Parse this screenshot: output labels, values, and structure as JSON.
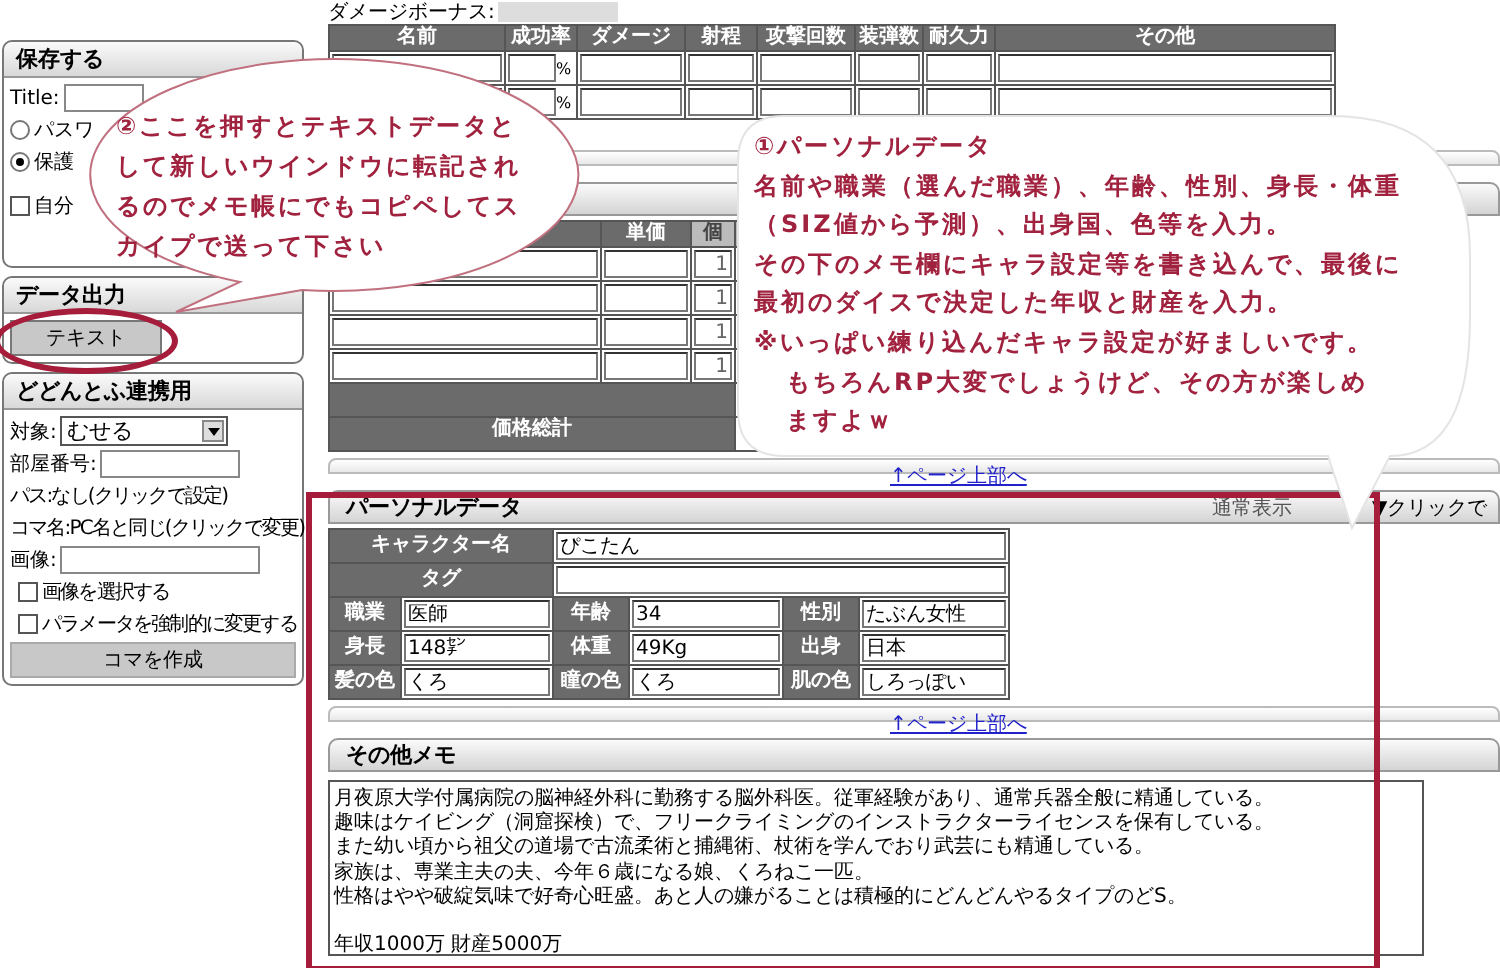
{
  "sidebar": {
    "save": {
      "title": "保存する",
      "title_label": "Title:",
      "options": [
        {
          "label": "パスワ",
          "selected": false
        },
        {
          "label": "保護",
          "selected": true
        }
      ],
      "hide_option": {
        "label": "自分",
        "checked": false
      }
    },
    "export": {
      "title": "データ出力",
      "button": "テキスト"
    },
    "dodontof": {
      "title": "どどんとふ連携用",
      "target_label": "対象:",
      "target_value": "むせる",
      "room_label": "部屋番号:",
      "password_line": "パス:なし(クリックで設定)",
      "piece_name_line": "コマ名:PC名と同じ(クリックで変更)",
      "image_label": "画像:",
      "checks": [
        {
          "label": "画像を選択する",
          "checked": false
        },
        {
          "label": "パラメータを強制的に変更する",
          "checked": false
        }
      ],
      "create_button": "コマを作成"
    }
  },
  "weapons": {
    "damage_bonus_label": "ダメージボーナス:",
    "columns": [
      "名前",
      "成功率",
      "ダメージ",
      "射程",
      "攻撃回数",
      "装弾数",
      "耐久力",
      "その他"
    ],
    "rows": [
      {
        "unit": "%"
      },
      {
        "unit": "%"
      }
    ]
  },
  "items": {
    "columns": [
      "単価",
      "個"
    ],
    "rows": [
      {
        "count": "1"
      },
      {
        "count": "1"
      },
      {
        "count": "1"
      },
      {
        "count": "1"
      }
    ],
    "total_label": "価格総計",
    "page_top_link": "↑ページ上部へ"
  },
  "personal": {
    "title": "パーソナルデータ",
    "view_mode": "通常表示",
    "toggle": "▼クリックで",
    "name_label": "キャラクター名",
    "name": "ぴこたん",
    "tag_label": "タグ",
    "rows": [
      {
        "cells": [
          {
            "label": "職業",
            "value": "医師"
          },
          {
            "label": "年齢",
            "value": "34"
          },
          {
            "label": "性別",
            "value": "たぶん女性"
          }
        ]
      },
      {
        "cells": [
          {
            "label": "身長",
            "value": "148㌢"
          },
          {
            "label": "体重",
            "value": "49Kg"
          },
          {
            "label": "出身",
            "value": "日本"
          }
        ]
      },
      {
        "cells": [
          {
            "label": "髪の色",
            "value": "くろ"
          },
          {
            "label": "瞳の色",
            "value": "くろ"
          },
          {
            "label": "肌の色",
            "value": "しろっぽい"
          }
        ]
      }
    ],
    "page_top_link": "↑ページ上部へ"
  },
  "memo": {
    "title": "その他メモ",
    "paragraphs": [
      {
        "lines": [
          "月夜原大学付属病院の脳神経外科に勤務する脳外科医。従軍経験があり、通常兵器全般に精通している。",
          "趣味はケイビング（洞窟探検）で、フリークライミングのインストラクターライセンスを保有している。",
          "また幼い頃から祖父の道場で古流柔術と捕縄術、杖術を学んでおり武芸にも精通している。",
          "家族は、専業主夫の夫、今年６歳になる娘、くろねこ一匹。",
          "性格はやや破綻気味で好奇心旺盛。あと人の嫌がることは積極的にどんどんやるタイプのどS。"
        ]
      },
      {
        "lines": [
          "年収1000万 財産5000万"
        ]
      }
    ]
  },
  "callouts": [
    {
      "kind": "oval",
      "lines": [
        {
          "text": "②ここを押すとテキストデータと",
          "indent": false
        },
        {
          "text": "して新しいウインドウに転記され",
          "indent": false
        },
        {
          "text": "るのでメモ帳にでもコピペしてス",
          "indent": false
        },
        {
          "text": "カイプで送って下さい",
          "indent": false
        }
      ]
    },
    {
      "kind": "cloud",
      "lines": [
        {
          "text": "①パーソナルデータ",
          "indent": false
        },
        {
          "text": "名前や職業（選んだ職業）、年齢、性別、身長・体重",
          "indent": false
        },
        {
          "text": "（SIZ値から予測）、出身国、色等を入力。",
          "indent": false
        },
        {
          "text": "その下のメモ欄にキャラ設定等を書き込んで、最後に",
          "indent": false
        },
        {
          "text": "最初のダイスで決定した年収と財産を入力。",
          "indent": false
        },
        {
          "text": "※いっぱい練り込んだキャラ設定が好ましいです。",
          "indent": false
        },
        {
          "text": "もちろんRP大変でしょうけど、その方が楽しめ",
          "indent": true
        },
        {
          "text": "ますよｗ",
          "indent": true
        }
      ]
    }
  ]
}
